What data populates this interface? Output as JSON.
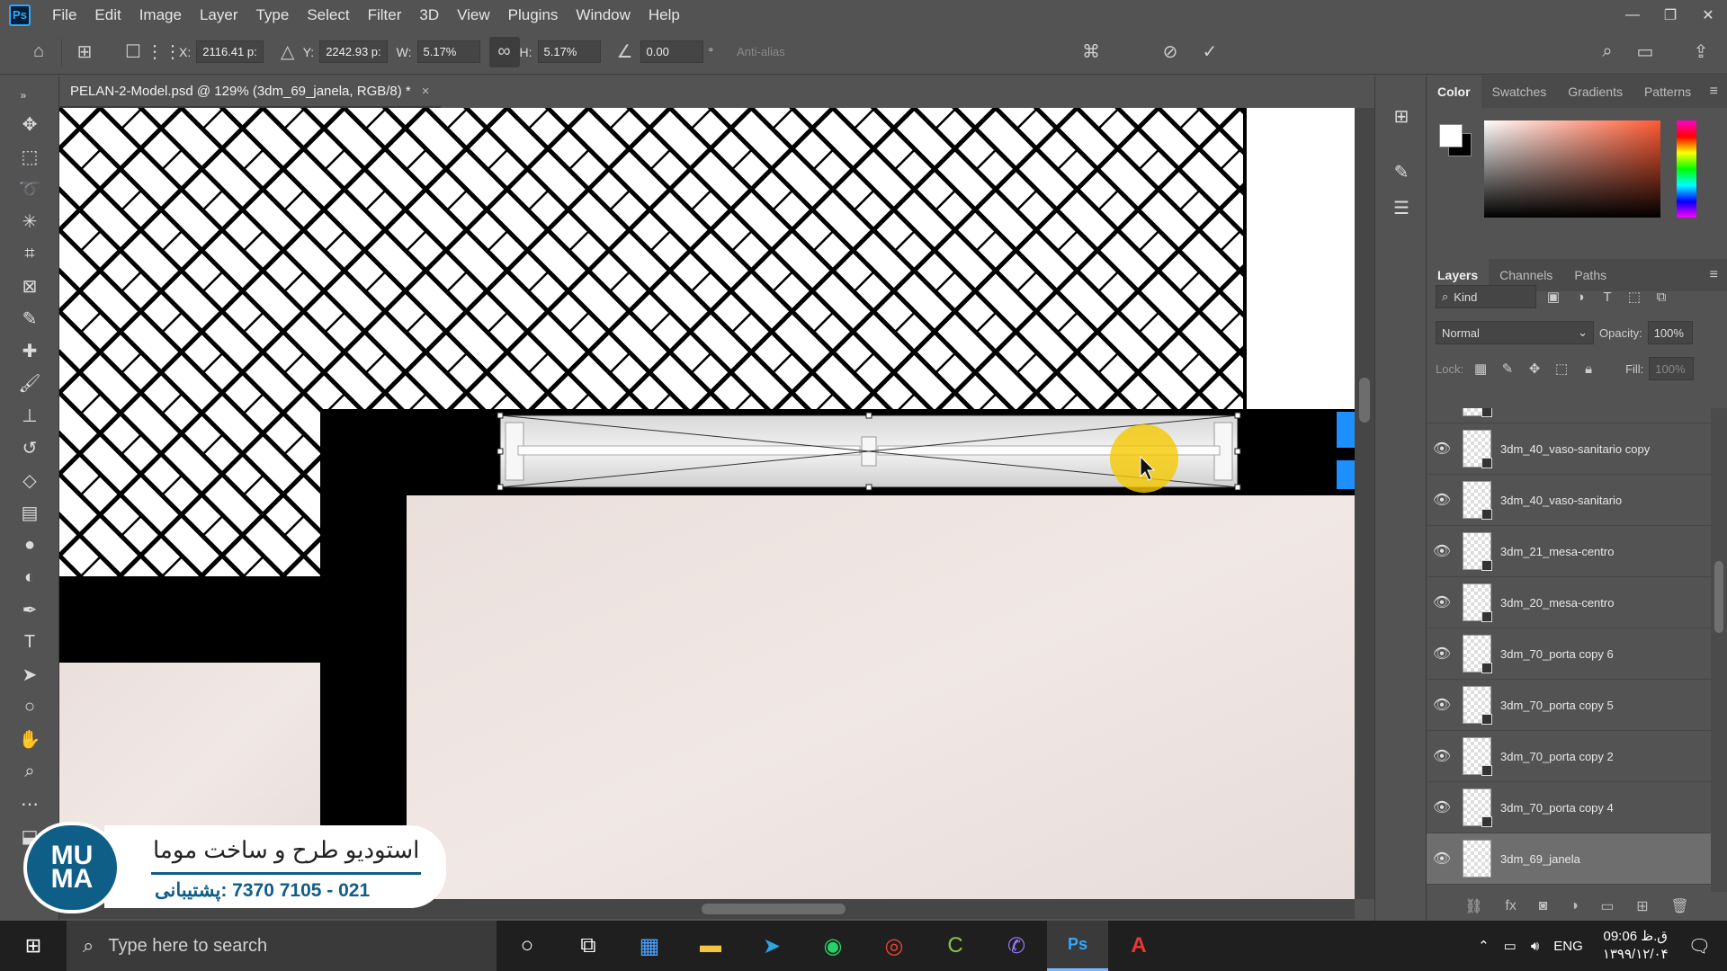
{
  "menubar": {
    "logo": "Ps",
    "items": [
      "File",
      "Edit",
      "Image",
      "Layer",
      "Type",
      "Select",
      "Filter",
      "3D",
      "View",
      "Plugins",
      "Window",
      "Help"
    ],
    "controls": [
      "—",
      "❐",
      "✕"
    ]
  },
  "options": {
    "x_label": "X:",
    "x_value": "2116.41 p:",
    "y_label": "Y:",
    "y_value": "2242.93 p:",
    "w_label": "W:",
    "w_value": "5.17%",
    "h_label": "H:",
    "h_value": "5.17%",
    "angle_value": "0.00",
    "degree": "°",
    "antialias": "Anti-alias"
  },
  "document": {
    "tab_title": "PELAN-2-Model.psd @ 129% (3dm_69_janela, RGB/8) *",
    "tab_close": "×"
  },
  "color_panel": {
    "tabs": [
      "Color",
      "Swatches",
      "Gradients",
      "Patterns"
    ],
    "active": "Color"
  },
  "layers_panel": {
    "tabs": [
      "Layers",
      "Channels",
      "Paths"
    ],
    "active": "Layers",
    "filter_placeholder": "Kind",
    "blend_mode": "Normal",
    "opacity_label": "Opacity:",
    "opacity_value": "100%",
    "lock_label": "Lock:",
    "fill_label": "Fill:",
    "fill_value": "100%",
    "layers": [
      {
        "name": "3dm_40_vaso-sanitario copy",
        "selected": false
      },
      {
        "name": "3dm_40_vaso-sanitario",
        "selected": false
      },
      {
        "name": "3dm_21_mesa-centro",
        "selected": false
      },
      {
        "name": "3dm_20_mesa-centro",
        "selected": false
      },
      {
        "name": "3dm_70_porta copy 6",
        "selected": false
      },
      {
        "name": "3dm_70_porta copy 5",
        "selected": false
      },
      {
        "name": "3dm_70_porta copy 2",
        "selected": false
      },
      {
        "name": "3dm_70_porta copy 4",
        "selected": false
      },
      {
        "name": "3dm_69_janela",
        "selected": true
      }
    ]
  },
  "watermark": {
    "logo": "MU\nMA",
    "title": "استودیو طرح و ساخت موما",
    "phone": "021 - 7105 7370 :پشتیبانی"
  },
  "taskbar": {
    "search_placeholder": "Type here to search",
    "lang": "ENG",
    "time": "09:06 ق.ظ",
    "date": "۱۳۹۹/۱۲/۰۴"
  },
  "colors": {
    "accent": "#31a8ff",
    "selection_blue": "#1e8fff",
    "cursor_highlight": "#f5c800",
    "floor_tint": "#efe4e0"
  }
}
